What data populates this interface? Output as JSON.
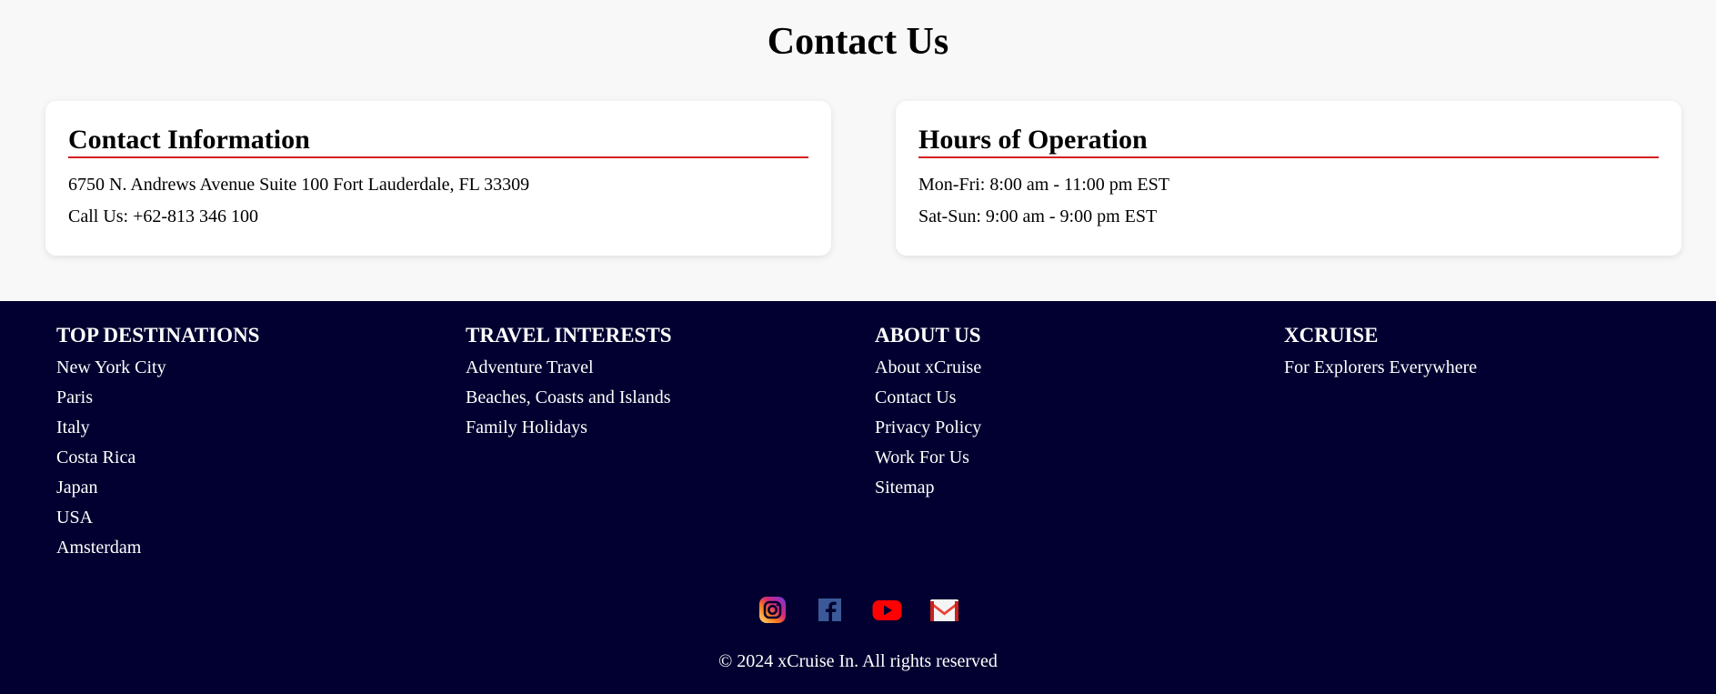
{
  "contact": {
    "title": "Contact Us",
    "info": {
      "heading": "Contact Information",
      "address": "6750 N. Andrews Avenue Suite 100 Fort Lauderdale, FL 33309",
      "phone": "Call Us: +62-813 346 100"
    },
    "hours": {
      "heading": "Hours of Operation",
      "weekday": "Mon-Fri: 8:00 am - 11:00 pm EST",
      "weekend": "Sat-Sun: 9:00 am - 9:00 pm EST"
    },
    "accent_color": "#d42020"
  },
  "footer": {
    "background": "#010030",
    "columns": [
      {
        "heading": "TOP DESTINATIONS",
        "links": [
          "New York City",
          "Paris",
          "Italy",
          "Costa Rica",
          "Japan",
          "USA",
          "Amsterdam"
        ]
      },
      {
        "heading": "TRAVEL INTERESTS",
        "links": [
          "Adventure Travel",
          "Beaches, Coasts and Islands",
          "Family Holidays"
        ]
      },
      {
        "heading": "ABOUT US",
        "links": [
          "About xCruise",
          "Contact Us",
          "Privacy Policy",
          "Work For Us",
          "Sitemap"
        ]
      },
      {
        "heading": "XCRUISE",
        "links": [
          "For Explorers Everywhere"
        ]
      }
    ],
    "social_icons": [
      "instagram-icon",
      "facebook-icon",
      "youtube-icon",
      "gmail-icon"
    ],
    "copyright": "© 2024 xCruise In. All rights reserved"
  }
}
